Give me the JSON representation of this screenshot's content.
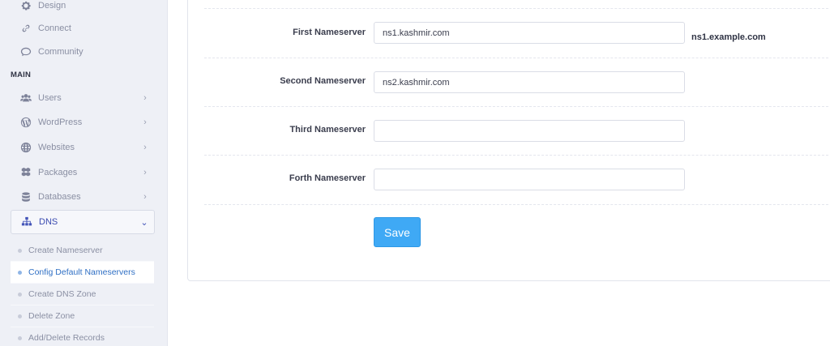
{
  "sidebar": {
    "top_items": [
      {
        "label": "Design",
        "icon": "gear-icon"
      },
      {
        "label": "Connect",
        "icon": "link-icon"
      },
      {
        "label": "Community",
        "icon": "comments-icon"
      }
    ],
    "section_title": "MAIN",
    "main_items": [
      {
        "label": "Users",
        "icon": "users-icon",
        "chevron": "›"
      },
      {
        "label": "WordPress",
        "icon": "wordpress-icon",
        "chevron": "›"
      },
      {
        "label": "Websites",
        "icon": "globe-icon",
        "chevron": "›"
      },
      {
        "label": "Packages",
        "icon": "cubes-icon",
        "chevron": "›"
      },
      {
        "label": "Databases",
        "icon": "database-icon",
        "chevron": "›"
      },
      {
        "label": "DNS",
        "icon": "sitemap-icon",
        "chevron": "⌄"
      }
    ],
    "dns_submenu": [
      {
        "label": "Create Nameserver"
      },
      {
        "label": "Config Default Nameservers"
      },
      {
        "label": "Create DNS Zone"
      },
      {
        "label": "Delete Zone"
      },
      {
        "label": "Add/Delete Records"
      }
    ]
  },
  "form": {
    "first": {
      "label": "First Nameserver",
      "value": "ns1.kashmir.com",
      "hint": "ns1.example.com"
    },
    "second": {
      "label": "Second Nameserver",
      "value": "ns2.kashmir.com"
    },
    "third": {
      "label": "Third Nameserver",
      "value": ""
    },
    "fourth": {
      "label": "Forth Nameserver",
      "value": ""
    },
    "save_label": "Save"
  },
  "colors": {
    "accent": "#3fa9f5",
    "active_link": "#2f6fc4",
    "sidebar_bg": "#eef0f6"
  }
}
